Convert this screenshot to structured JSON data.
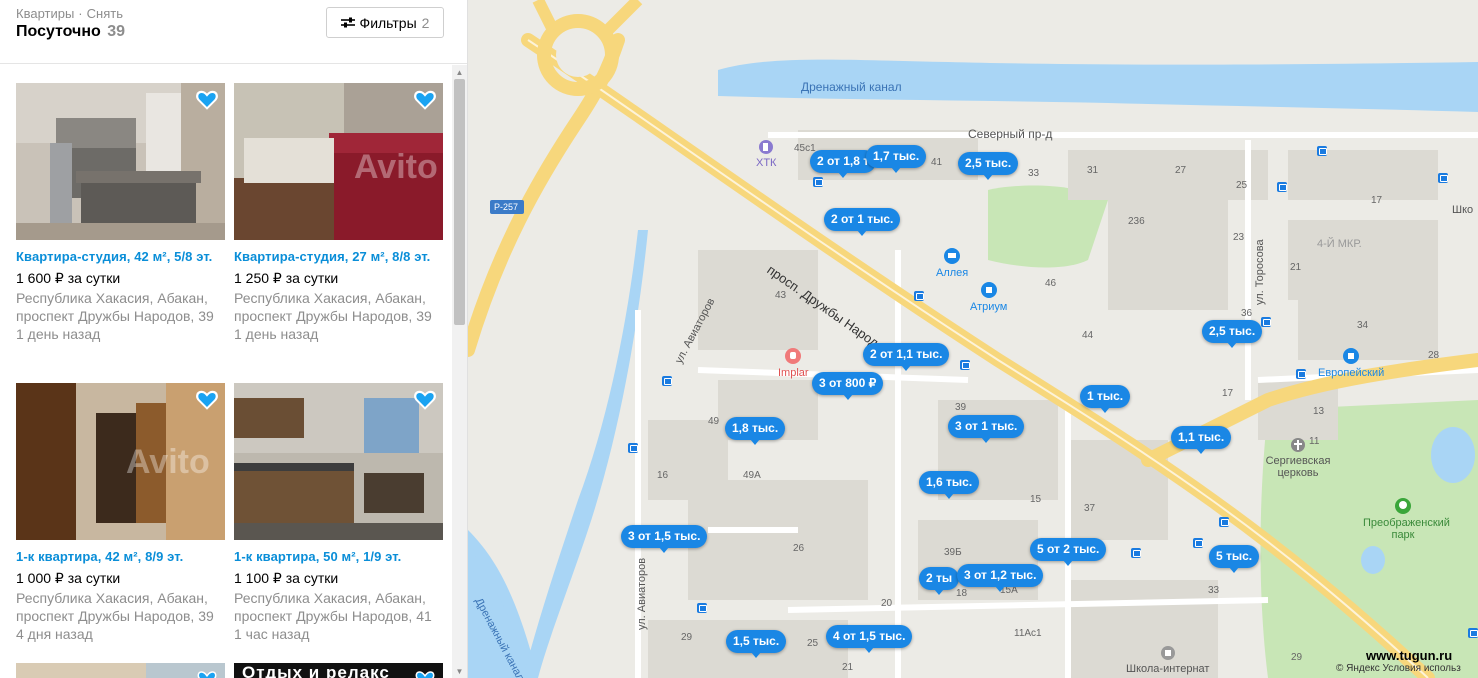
{
  "header": {
    "breadcrumb": [
      "Квартиры",
      "Снять"
    ],
    "title": "Посуточно",
    "count": "39",
    "filters_label": "Фильтры",
    "filters_count": "2"
  },
  "listings": [
    {
      "title": "Квартира-студия, 42 м², 5/8 эт.",
      "price": "1 600 ₽ за сутки",
      "address": "Республика Хакасия, Абакан, проспект Дружбы Народов, 39",
      "date": "1 день назад"
    },
    {
      "title": "Квартира-студия, 27 м², 8/8 эт.",
      "price": "1 250 ₽ за сутки",
      "address": "Республика Хакасия, Абакан, проспект Дружбы Народов, 39",
      "date": "1 день назад"
    },
    {
      "title": "1-к квартира, 42 м², 8/9 эт.",
      "price": "1 000 ₽ за сутки",
      "address": "Республика Хакасия, Абакан, проспект Дружбы Народов, 39",
      "date": "4 дня назад"
    },
    {
      "title": "1-к квартира, 50 м², 1/9 эт.",
      "price": "1 100 ₽ за сутки",
      "address": "Республика Хакасия, Абакан, проспект Дружбы Народов, 41",
      "date": "1 час назад"
    }
  ],
  "partial_card_caption": "Отдых и релакс",
  "photo_watermark": "Avito",
  "map": {
    "streets": {
      "canal": "Дренажный канал",
      "canal_vertical": "Дренажный канал",
      "severny": "Северный пр-д",
      "prospekt": "просп. Дружбы Народов",
      "aviatorov_top": "ул. Авиаторов",
      "aviatorov_bottom": "ул. Авиаторов",
      "torosova": "ул. Торосова",
      "road_sign": "Р-257",
      "district": "4-Й МКР."
    },
    "pois": {
      "htk": "ХТК",
      "alleya": "Аллея",
      "atrium": "Атриум",
      "implant": "Implar",
      "evropeisky": "Европейский",
      "church": "Сергиевская церковь",
      "park": "Преображенский парк",
      "school": "Школа-интернат",
      "school_top": "Шко"
    },
    "house_numbers": [
      "45с1",
      "41",
      "33",
      "31",
      "27",
      "25",
      "17",
      "236",
      "23",
      "21",
      "43",
      "46",
      "44",
      "36",
      "34",
      "28",
      "49",
      "49А",
      "16",
      "39",
      "17",
      "13",
      "11",
      "37",
      "15",
      "26",
      "39Б",
      "18",
      "15А",
      "20",
      "11Ас1",
      "33",
      "29",
      "29",
      "25",
      "21"
    ],
    "price_pins": [
      "2 от 1,8 т",
      "1,7 тыс.",
      "2,5 тыс.",
      "2 от 1 тыс.",
      "2 от 1,1 тыс.",
      "3 от 800 ₽",
      "1,8 тыс.",
      "3 от 1 тыс.",
      "1 тыс.",
      "2,5 тыс.",
      "1,1 тыс.",
      "1,6 тыс.",
      "3 от 1,5 тыс.",
      "5 от 2 тыс.",
      "5 тыс.",
      "2 ты",
      "3 от 1,2 тыс.",
      "1,5 тыс.",
      "4 от 1,5 тыс."
    ],
    "attribution": "© Яндекс Условия использ",
    "watermark": "www.tugun.ru"
  },
  "colors": {
    "accent": "#0a8ed8",
    "pin": "#1a87e5",
    "water": "#a9d5f5",
    "park": "#c8e6b6",
    "road_major": "#f7d77c"
  }
}
